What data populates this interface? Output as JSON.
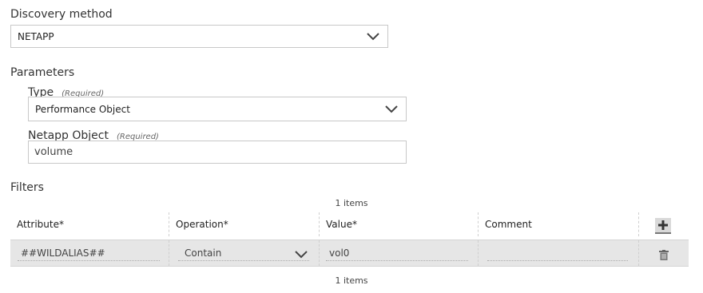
{
  "discovery": {
    "label": "Discovery method",
    "value": "NETAPP"
  },
  "parameters": {
    "label": "Parameters",
    "type": {
      "label": "Type",
      "required": "(Required)",
      "value": "Performance Object"
    },
    "object": {
      "label": "Netapp Object",
      "required": "(Required)",
      "value": "volume"
    }
  },
  "filters": {
    "label": "Filters",
    "count_top": "1 items",
    "count_bottom": "1 items",
    "columns": [
      "Attribute*",
      "Operation*",
      "Value*",
      "Comment"
    ],
    "rows": [
      {
        "attribute": "##WILDALIAS##",
        "operation": "Contain",
        "value": "vol0",
        "comment": ""
      }
    ],
    "add_icon": "plus-icon",
    "delete_icon": "trash-icon"
  }
}
